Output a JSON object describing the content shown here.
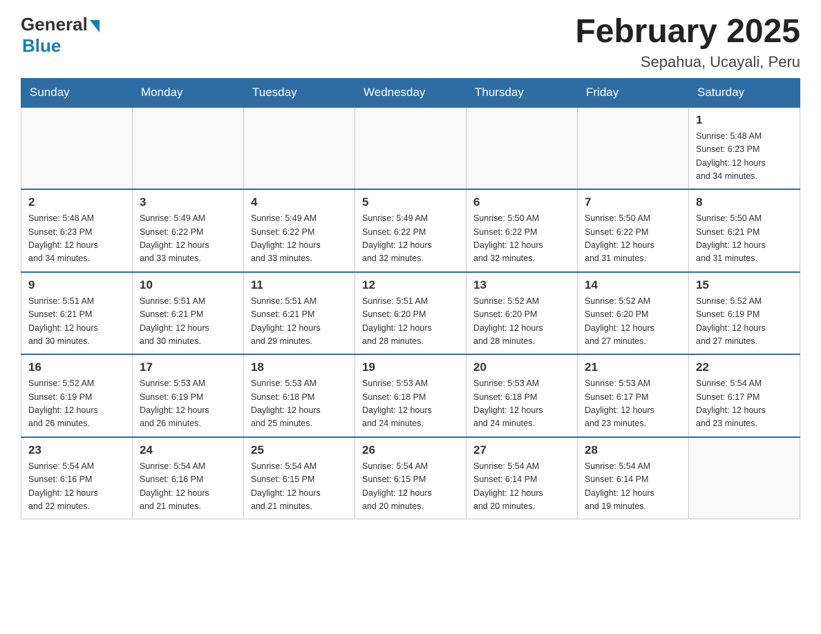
{
  "logo": {
    "general": "General",
    "blue": "Blue"
  },
  "header": {
    "title": "February 2025",
    "location": "Sepahua, Ucayali, Peru"
  },
  "days_of_week": [
    "Sunday",
    "Monday",
    "Tuesday",
    "Wednesday",
    "Thursday",
    "Friday",
    "Saturday"
  ],
  "weeks": [
    [
      {
        "day": "",
        "info": ""
      },
      {
        "day": "",
        "info": ""
      },
      {
        "day": "",
        "info": ""
      },
      {
        "day": "",
        "info": ""
      },
      {
        "day": "",
        "info": ""
      },
      {
        "day": "",
        "info": ""
      },
      {
        "day": "1",
        "info": "Sunrise: 5:48 AM\nSunset: 6:23 PM\nDaylight: 12 hours\nand 34 minutes."
      }
    ],
    [
      {
        "day": "2",
        "info": "Sunrise: 5:48 AM\nSunset: 6:23 PM\nDaylight: 12 hours\nand 34 minutes."
      },
      {
        "day": "3",
        "info": "Sunrise: 5:49 AM\nSunset: 6:22 PM\nDaylight: 12 hours\nand 33 minutes."
      },
      {
        "day": "4",
        "info": "Sunrise: 5:49 AM\nSunset: 6:22 PM\nDaylight: 12 hours\nand 33 minutes."
      },
      {
        "day": "5",
        "info": "Sunrise: 5:49 AM\nSunset: 6:22 PM\nDaylight: 12 hours\nand 32 minutes."
      },
      {
        "day": "6",
        "info": "Sunrise: 5:50 AM\nSunset: 6:22 PM\nDaylight: 12 hours\nand 32 minutes."
      },
      {
        "day": "7",
        "info": "Sunrise: 5:50 AM\nSunset: 6:22 PM\nDaylight: 12 hours\nand 31 minutes."
      },
      {
        "day": "8",
        "info": "Sunrise: 5:50 AM\nSunset: 6:21 PM\nDaylight: 12 hours\nand 31 minutes."
      }
    ],
    [
      {
        "day": "9",
        "info": "Sunrise: 5:51 AM\nSunset: 6:21 PM\nDaylight: 12 hours\nand 30 minutes."
      },
      {
        "day": "10",
        "info": "Sunrise: 5:51 AM\nSunset: 6:21 PM\nDaylight: 12 hours\nand 30 minutes."
      },
      {
        "day": "11",
        "info": "Sunrise: 5:51 AM\nSunset: 6:21 PM\nDaylight: 12 hours\nand 29 minutes."
      },
      {
        "day": "12",
        "info": "Sunrise: 5:51 AM\nSunset: 6:20 PM\nDaylight: 12 hours\nand 28 minutes."
      },
      {
        "day": "13",
        "info": "Sunrise: 5:52 AM\nSunset: 6:20 PM\nDaylight: 12 hours\nand 28 minutes."
      },
      {
        "day": "14",
        "info": "Sunrise: 5:52 AM\nSunset: 6:20 PM\nDaylight: 12 hours\nand 27 minutes."
      },
      {
        "day": "15",
        "info": "Sunrise: 5:52 AM\nSunset: 6:19 PM\nDaylight: 12 hours\nand 27 minutes."
      }
    ],
    [
      {
        "day": "16",
        "info": "Sunrise: 5:52 AM\nSunset: 6:19 PM\nDaylight: 12 hours\nand 26 minutes."
      },
      {
        "day": "17",
        "info": "Sunrise: 5:53 AM\nSunset: 6:19 PM\nDaylight: 12 hours\nand 26 minutes."
      },
      {
        "day": "18",
        "info": "Sunrise: 5:53 AM\nSunset: 6:18 PM\nDaylight: 12 hours\nand 25 minutes."
      },
      {
        "day": "19",
        "info": "Sunrise: 5:53 AM\nSunset: 6:18 PM\nDaylight: 12 hours\nand 24 minutes."
      },
      {
        "day": "20",
        "info": "Sunrise: 5:53 AM\nSunset: 6:18 PM\nDaylight: 12 hours\nand 24 minutes."
      },
      {
        "day": "21",
        "info": "Sunrise: 5:53 AM\nSunset: 6:17 PM\nDaylight: 12 hours\nand 23 minutes."
      },
      {
        "day": "22",
        "info": "Sunrise: 5:54 AM\nSunset: 6:17 PM\nDaylight: 12 hours\nand 23 minutes."
      }
    ],
    [
      {
        "day": "23",
        "info": "Sunrise: 5:54 AM\nSunset: 6:16 PM\nDaylight: 12 hours\nand 22 minutes."
      },
      {
        "day": "24",
        "info": "Sunrise: 5:54 AM\nSunset: 6:16 PM\nDaylight: 12 hours\nand 21 minutes."
      },
      {
        "day": "25",
        "info": "Sunrise: 5:54 AM\nSunset: 6:15 PM\nDaylight: 12 hours\nand 21 minutes."
      },
      {
        "day": "26",
        "info": "Sunrise: 5:54 AM\nSunset: 6:15 PM\nDaylight: 12 hours\nand 20 minutes."
      },
      {
        "day": "27",
        "info": "Sunrise: 5:54 AM\nSunset: 6:14 PM\nDaylight: 12 hours\nand 20 minutes."
      },
      {
        "day": "28",
        "info": "Sunrise: 5:54 AM\nSunset: 6:14 PM\nDaylight: 12 hours\nand 19 minutes."
      },
      {
        "day": "",
        "info": ""
      }
    ]
  ]
}
